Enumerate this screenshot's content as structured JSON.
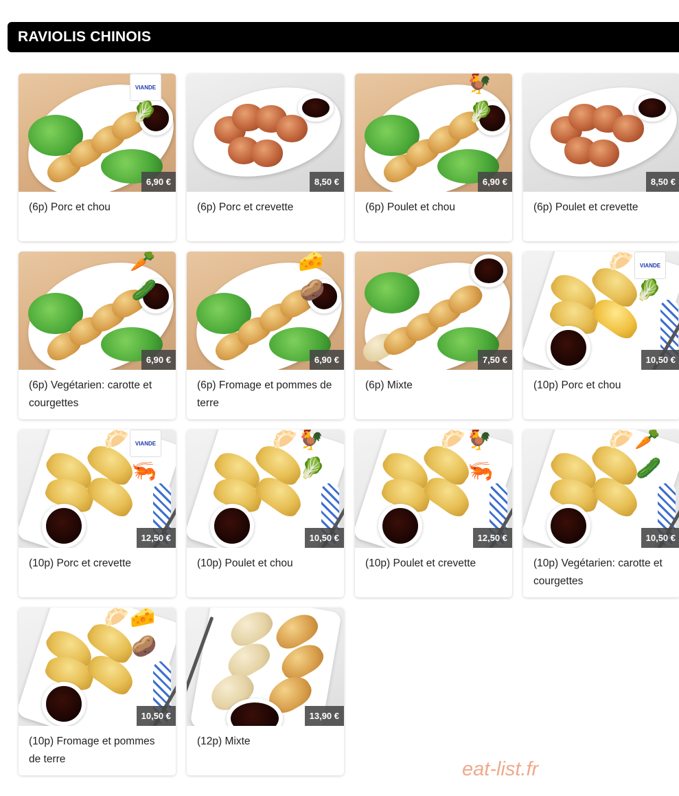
{
  "section": {
    "title": "RAVIOLIS CHINOIS"
  },
  "items": [
    {
      "name": "(6p) Porc et chou",
      "price": "6,90 €",
      "icons": [
        "france-label-icon",
        "cabbage-icon"
      ]
    },
    {
      "name": "(6p) Porc et crevette",
      "price": "8,50 €",
      "icons": []
    },
    {
      "name": "(6p) Poulet et chou",
      "price": "6,90 €",
      "icons": [
        "chicken-icon",
        "cabbage-icon"
      ]
    },
    {
      "name": "(6p) Poulet et crevette",
      "price": "8,50 €",
      "icons": []
    },
    {
      "name": "(6p) Vegétarien: carotte et courgettes",
      "price": "6,90 €",
      "icons": [
        "carrot-icon",
        "zucchini-icon"
      ]
    },
    {
      "name": "(6p) Fromage et pommes de terre",
      "price": "6,90 €",
      "icons": [
        "cheese-icon",
        "potato-icon"
      ]
    },
    {
      "name": "(6p) Mixte",
      "price": "7,50 €",
      "icons": []
    },
    {
      "name": "(10p) Porc et chou",
      "price": "10,50 €",
      "icons": [
        "dumpling-icon",
        "france-label-icon",
        "cabbage-icon"
      ]
    },
    {
      "name": "(10p) Porc et crevette",
      "price": "12,50 €",
      "icons": [
        "dumpling-icon",
        "france-label-icon",
        "shrimp-icon"
      ]
    },
    {
      "name": "(10p) Poulet et chou",
      "price": "10,50 €",
      "icons": [
        "dumpling-icon",
        "chicken-icon",
        "cabbage-icon"
      ]
    },
    {
      "name": "(10p) Poulet et crevette",
      "price": "12,50 €",
      "icons": [
        "dumpling-icon",
        "chicken-icon",
        "shrimp-icon"
      ]
    },
    {
      "name": "(10p) Vegétarien: carotte et courgettes",
      "price": "10,50 €",
      "icons": [
        "dumpling-icon",
        "carrot-icon",
        "zucchini-icon"
      ]
    },
    {
      "name": "(10p) Fromage et pommes de terre",
      "price": "10,50 €",
      "icons": [
        "dumpling-icon",
        "cheese-icon",
        "potato-icon"
      ]
    },
    {
      "name": "(12p) Mixte",
      "price": "13,90 €",
      "icons": []
    }
  ],
  "badge": {
    "france_label_line1": "VIANDE",
    "france_label_line2": "FRANÇAISE"
  },
  "watermark": "eat-list.fr",
  "colors": {
    "header_bg": "#000000",
    "header_text": "#ffffff",
    "price_bg": "#464646",
    "watermark": "#f0a98a"
  }
}
